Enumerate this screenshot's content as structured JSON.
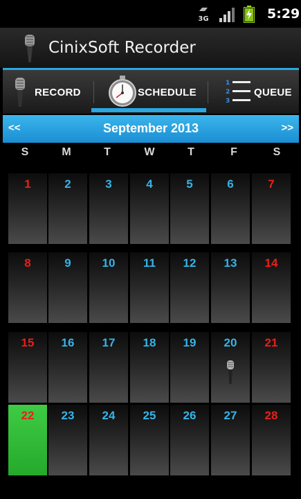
{
  "status_bar": {
    "network_label": "3G",
    "network_icon": "3g-data-icon",
    "signal_icon": "signal-strength-icon",
    "battery_icon": "battery-charging-icon",
    "time": "5:29"
  },
  "app": {
    "title": "CinixSoft Recorder",
    "icon": "microphone-icon"
  },
  "tabs": [
    {
      "label": "RECORD",
      "icon": "microphone-icon",
      "selected": false
    },
    {
      "label": "SCHEDULE",
      "icon": "stopwatch-icon",
      "selected": true
    },
    {
      "label": "QUEUE",
      "icon": "numbered-list-icon",
      "selected": false
    }
  ],
  "calendar": {
    "prev_label": "<<",
    "next_label": ">>",
    "month_title": "September 2013",
    "weekdays": [
      "S",
      "M",
      "T",
      "W",
      "T",
      "F",
      "S"
    ],
    "weeks": [
      [
        "1",
        "2",
        "3",
        "4",
        "5",
        "6",
        "7"
      ],
      [
        "8",
        "9",
        "10",
        "11",
        "12",
        "13",
        "14"
      ],
      [
        "15",
        "16",
        "17",
        "18",
        "19",
        "20",
        "21"
      ],
      [
        "22",
        "23",
        "24",
        "25",
        "26",
        "27",
        "28"
      ]
    ],
    "today": "22",
    "scheduled_days": [
      "20"
    ],
    "scheduled_icon": "microphone-icon"
  },
  "colors": {
    "accent": "#2aa7e0",
    "weekday_number": "#35b4e8",
    "weekend_number": "#e8201c",
    "today_background": "#34bd39"
  }
}
